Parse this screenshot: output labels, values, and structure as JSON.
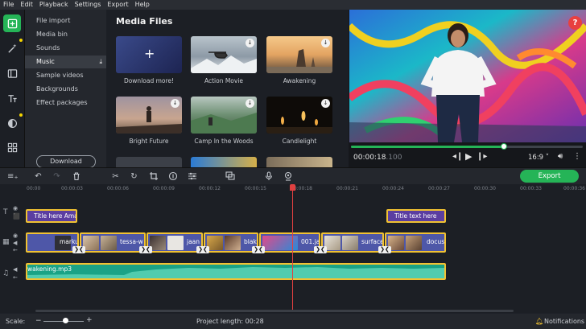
{
  "menu": [
    "File",
    "Edit",
    "Playback",
    "Settings",
    "Export",
    "Help"
  ],
  "sidebar": {
    "categories": [
      {
        "label": "File import"
      },
      {
        "label": "Media bin"
      },
      {
        "label": "Sounds"
      },
      {
        "label": "Music",
        "selected": true
      },
      {
        "label": "Sample videos"
      },
      {
        "label": "Backgrounds"
      },
      {
        "label": "Effect packages"
      }
    ],
    "download_button": "Download"
  },
  "media": {
    "title": "Media Files",
    "items": [
      {
        "caption": "Download more!",
        "icon": "plus-icon"
      },
      {
        "caption": "Action Movie"
      },
      {
        "caption": "Awakening"
      },
      {
        "caption": "Bright Future"
      },
      {
        "caption": "Camp In the Woods"
      },
      {
        "caption": "Candlelight"
      }
    ]
  },
  "player": {
    "time": "00:00:18",
    "time_ms": ".100",
    "progress": 0.66,
    "aspect": "16:9 ˅",
    "help": "?"
  },
  "toolbar": {
    "export_label": "Export"
  },
  "ruler": [
    "00:00",
    "00:00:03",
    "00:00:06",
    "00:00:09",
    "00:00:12",
    "00:00:15",
    "00:00:18",
    "00:00:21",
    "00:00:24",
    "00:00:27",
    "00:00:30",
    "00:00:33",
    "00:00:36"
  ],
  "timeline": {
    "titles": [
      {
        "label": "Title here Amaz"
      },
      {
        "label": "Title text here"
      }
    ],
    "videos": [
      {
        "label": "marku"
      },
      {
        "label": "tessa-w"
      },
      {
        "label": "jaan"
      },
      {
        "label": "blak"
      },
      {
        "label": "001.ja"
      },
      {
        "label": "surface"
      },
      {
        "label": "docus"
      }
    ],
    "audio": {
      "label": "wakening.mp3"
    }
  },
  "status": {
    "scale_label": "Scale:",
    "scale_value": 0.55,
    "project_length": "Project length:  00:28",
    "notifications": "Notifications"
  },
  "colors": {
    "accent": "#25b457",
    "clip_border": "#f1c232",
    "title_clip": "#5b3ea1",
    "video_clip": "#4e57a8",
    "audio_clip": "#1aa386",
    "playhead": "#e04040"
  }
}
